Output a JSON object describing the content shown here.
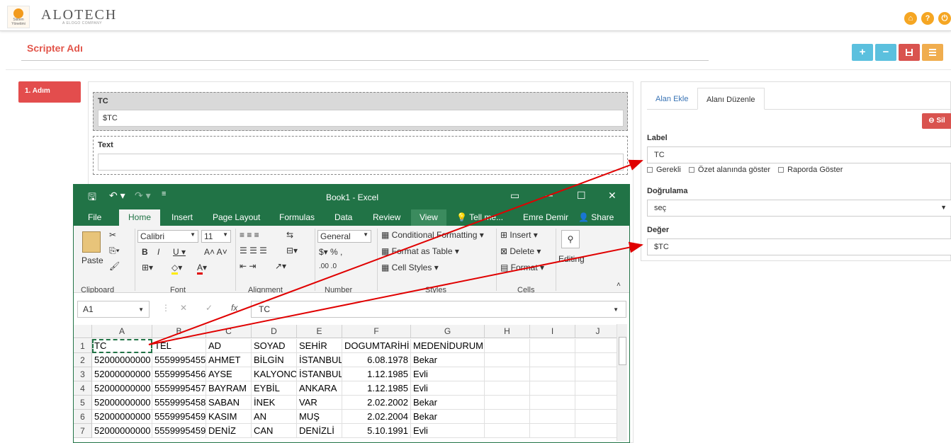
{
  "app": {
    "brand": "ALOTECH",
    "brand_sub": "A ELOGO COMPANY",
    "logo_text": "Sistem Yönetimi"
  },
  "topbar_icons": [
    "home-icon",
    "help-icon",
    "power-icon"
  ],
  "scripter": {
    "title": "Scripter Adı"
  },
  "actions": {
    "add_label": "+",
    "remove_label": "−",
    "save_label": "💾",
    "list_label": "☰"
  },
  "step": {
    "label": "1. Adım"
  },
  "fields": [
    {
      "label": "TC",
      "value": "$TC"
    },
    {
      "label": "Text",
      "value": ""
    }
  ],
  "panel": {
    "tabs": [
      "Alan Ekle",
      "Alanı Düzenle"
    ],
    "delete_label": "Sil",
    "label_title": "Label",
    "label_value": "TC",
    "checks": [
      "Gerekli",
      "Özet alanında göster",
      "Raporda Göster"
    ],
    "validation_title": "Doğrulama",
    "validation_value": "seç",
    "value_title": "Değer",
    "value_value": "$TC"
  },
  "excel": {
    "title": "Book1 - Excel",
    "user": "Emre Demir",
    "share": "Share",
    "menus": [
      "File",
      "Home",
      "Insert",
      "Page Layout",
      "Formulas",
      "Data",
      "Review",
      "View",
      "Tell me..."
    ],
    "ribbon": {
      "paste": "Paste",
      "font_name": "Calibri",
      "font_size": "11",
      "number_format": "General",
      "conditional": "Conditional Formatting",
      "format_table": "Format as Table",
      "cell_styles": "Cell Styles",
      "insert": "Insert",
      "delete": "Delete",
      "format": "Format",
      "editing": "Editing",
      "groups": [
        "Clipboard",
        "Font",
        "Alignment",
        "Number",
        "Styles",
        "Cells"
      ]
    },
    "name_box": "A1",
    "formula": "TC",
    "columns": [
      "A",
      "B",
      "C",
      "D",
      "E",
      "F",
      "G",
      "H",
      "I",
      "J"
    ],
    "rows": [
      [
        "TC",
        "TEL",
        "AD",
        "SOYAD",
        "SEHİR",
        "DOGUMTARİHİ",
        "MEDENİDURUM"
      ],
      [
        "52000000000",
        "5559995455",
        "AHMET",
        "BİLGİN",
        "İSTANBUL",
        "6.08.1978",
        "Bekar"
      ],
      [
        "52000000000",
        "5559995456",
        "AYSE",
        "KALYONCU",
        "İSTANBUL",
        "1.12.1985",
        "Evli"
      ],
      [
        "52000000000",
        "5559995457",
        "BAYRAM",
        "EYBİL",
        "ANKARA",
        "1.12.1985",
        "Evli"
      ],
      [
        "52000000000",
        "5559995458",
        "SABAN",
        "İNEK",
        "VAR",
        "2.02.2002",
        "Bekar"
      ],
      [
        "52000000000",
        "5559995459",
        "KASIM",
        "AN",
        "MUŞ",
        "2.02.2004",
        "Bekar"
      ],
      [
        "52000000000",
        "5559995459",
        "DENİZ",
        "CAN",
        "DENİZLİ",
        "5.10.1991",
        "Evli"
      ]
    ]
  },
  "colors": {
    "accent_red": "#e34d4d",
    "excel_green": "#217346",
    "arrow_red": "#e00000"
  }
}
